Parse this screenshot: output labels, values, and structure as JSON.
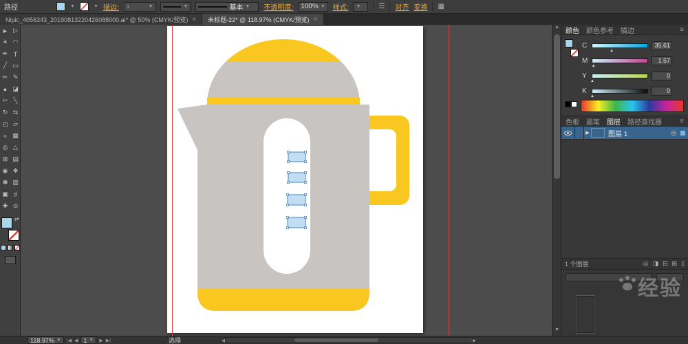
{
  "topbar": {
    "mode": "路径",
    "stroke": "描边:",
    "brush": "基本",
    "opacity_label": "不透明度:",
    "opacity": "100%",
    "style": "样式:",
    "align": "对齐",
    "transform": "变换"
  },
  "tabs": [
    {
      "title": "Nipic_4056343_20190813220426088000.ai* @ 50% (CMYK/预览)",
      "close": "×"
    },
    {
      "title": "未标题-22* @ 118.97% (CMYK/预览)",
      "close": "×"
    }
  ],
  "tools": [
    {
      "name": "selection-tool",
      "glyph": "►"
    },
    {
      "name": "direct-selection-tool",
      "glyph": "▷"
    },
    {
      "name": "magic-wand-tool",
      "glyph": "✶"
    },
    {
      "name": "lasso-tool",
      "glyph": "◠"
    },
    {
      "name": "pen-tool",
      "glyph": "✒"
    },
    {
      "name": "type-tool",
      "glyph": "T"
    },
    {
      "name": "line-segment-tool",
      "glyph": "╱"
    },
    {
      "name": "rectangle-tool",
      "glyph": "▭"
    },
    {
      "name": "paintbrush-tool",
      "glyph": "✏"
    },
    {
      "name": "pencil-tool",
      "glyph": "✎"
    },
    {
      "name": "blob-brush-tool",
      "glyph": "●"
    },
    {
      "name": "eraser-tool",
      "glyph": "◪"
    },
    {
      "name": "scissors-tool",
      "glyph": "✂"
    },
    {
      "name": "knife-tool",
      "glyph": "╲"
    },
    {
      "name": "rotate-tool",
      "glyph": "↻"
    },
    {
      "name": "reflect-tool",
      "glyph": "⇆"
    },
    {
      "name": "scale-tool",
      "glyph": "◰"
    },
    {
      "name": "shear-tool",
      "glyph": "▱"
    },
    {
      "name": "width-tool",
      "glyph": "≈"
    },
    {
      "name": "free-transform-tool",
      "glyph": "▦"
    },
    {
      "name": "shape-builder-tool",
      "glyph": "◎"
    },
    {
      "name": "perspective-grid-tool",
      "glyph": "△"
    },
    {
      "name": "mesh-tool",
      "glyph": "⊞"
    },
    {
      "name": "gradient-tool",
      "glyph": "▤"
    },
    {
      "name": "eyedropper-tool",
      "glyph": "◉"
    },
    {
      "name": "blend-tool",
      "glyph": "❖"
    },
    {
      "name": "symbol-sprayer-tool",
      "glyph": "✽"
    },
    {
      "name": "column-graph-tool",
      "glyph": "▥"
    },
    {
      "name": "artboard-tool",
      "glyph": "▣"
    },
    {
      "name": "slice-tool",
      "glyph": "#"
    },
    {
      "name": "hand-tool",
      "glyph": "✚"
    },
    {
      "name": "zoom-tool",
      "glyph": "⊙"
    }
  ],
  "color_panel": {
    "tabs": {
      "color": "颜色",
      "guide": "颜色参考",
      "stroke": "描边"
    },
    "cmyk": {
      "c": {
        "label": "C",
        "value": "35.61"
      },
      "m": {
        "label": "M",
        "value": "1.57"
      },
      "y": {
        "label": "Y",
        "value": "0"
      },
      "k": {
        "label": "K",
        "value": "0"
      }
    }
  },
  "panels": {
    "swatches": "色板",
    "brushes": "画笔",
    "layers": "图层",
    "pathfinder": "路径查找器"
  },
  "layers": {
    "name": "图层 1",
    "count": "1 个图层"
  },
  "status": {
    "zoom": "118.97%",
    "artboard": "1",
    "tool": "选择"
  },
  "watermark": {
    "text": "经验"
  },
  "colors": {
    "kettle_gray": "#c7c4c1",
    "kettle_yellow": "#f9c71f",
    "selection_stroke": "#3f87c4",
    "selection_fill": "#c2def2",
    "guide_red": "#d94343",
    "layer_highlight": "#39648c",
    "link_accent": "#e6a93e"
  }
}
